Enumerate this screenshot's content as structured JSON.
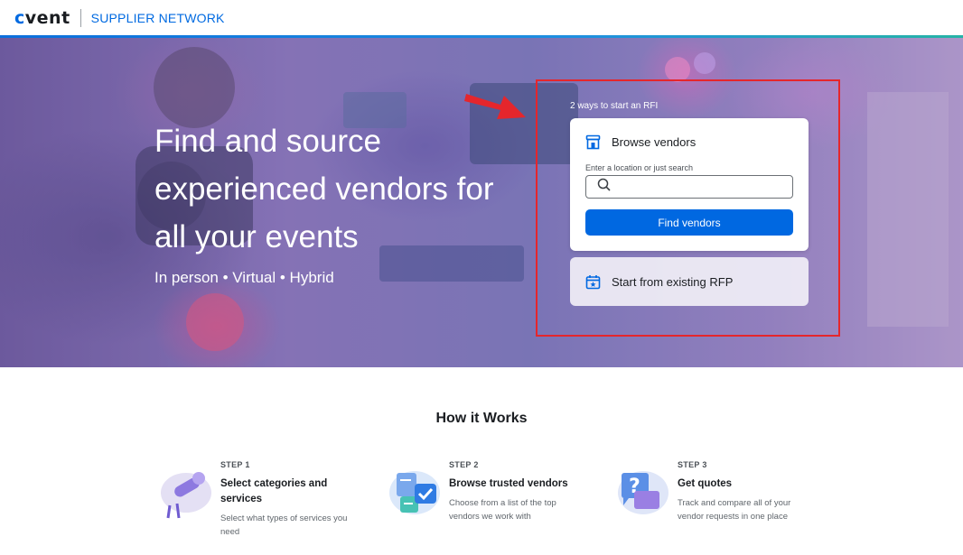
{
  "header": {
    "logo_text": "cvent",
    "network_label": "SUPPLIER NETWORK"
  },
  "hero": {
    "title": "Find and source experienced vendors for all your events",
    "subtitle": "In person • Virtual • Hybrid",
    "ways_label": "2 ways to start an RFI"
  },
  "browse": {
    "title": "Browse vendors",
    "search_label": "Enter a location or just search",
    "search_value": "",
    "search_placeholder": "",
    "button_label": "Find vendors"
  },
  "rfp": {
    "label": "Start from existing RFP"
  },
  "how": {
    "title": "How it Works",
    "steps": [
      {
        "num": "STEP 1",
        "title": "Select categories and services",
        "desc": "Select what types of services you need",
        "icon": "microphone-icon"
      },
      {
        "num": "STEP 2",
        "title": "Browse trusted vendors",
        "desc": "Choose from a list of the top vendors we work with",
        "icon": "checklist-icon"
      },
      {
        "num": "STEP 3",
        "title": "Get quotes",
        "desc": "Track and compare all of your vendor requests in one place",
        "icon": "question-chat-icon"
      }
    ]
  },
  "colors": {
    "brand": "#006ae1",
    "button": "#0068e1",
    "annotation": "#e5262c"
  }
}
